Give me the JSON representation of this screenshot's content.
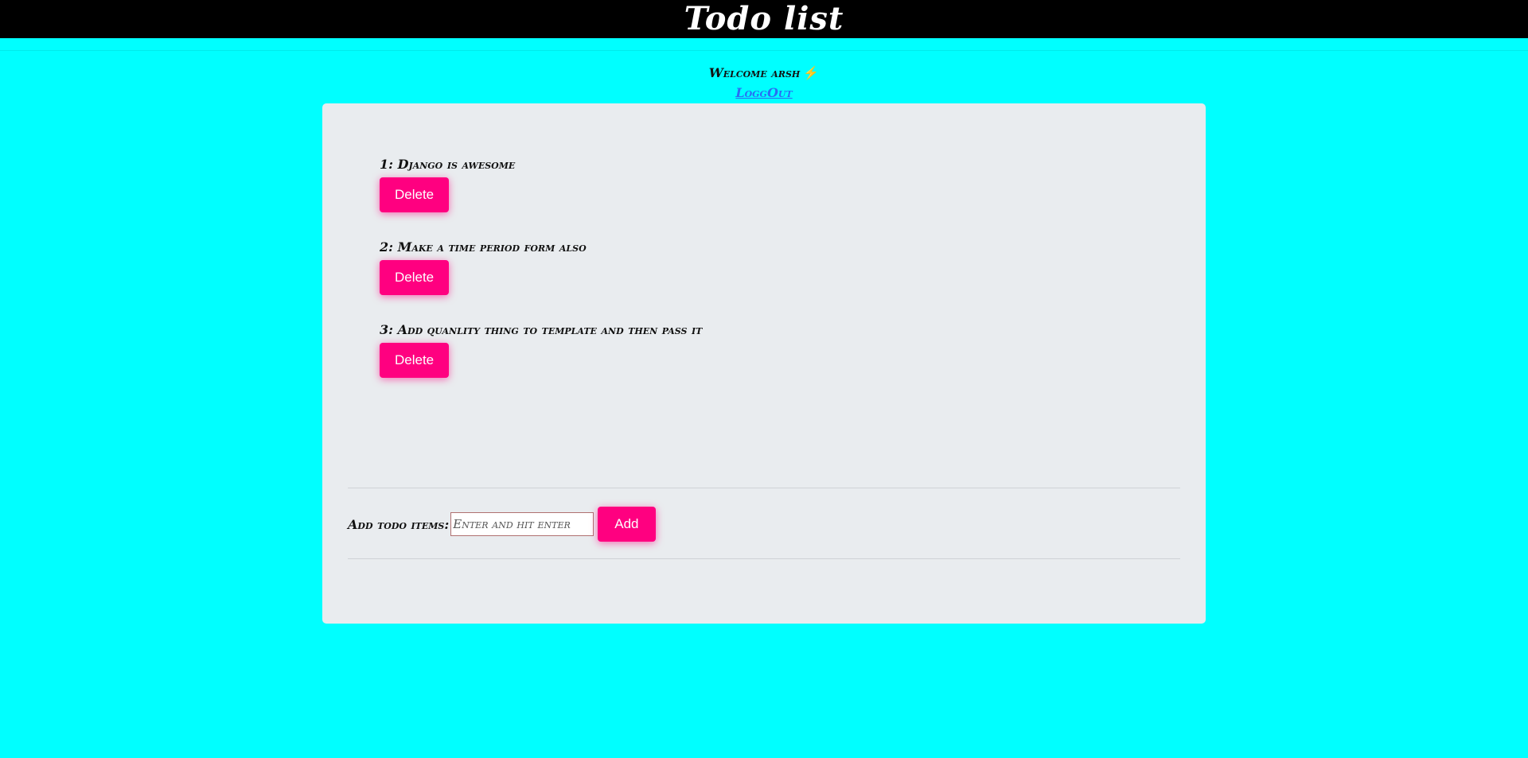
{
  "header": {
    "title": "Todo list"
  },
  "user": {
    "welcome": "Welcome arsh",
    "bolt_icon": "lightning-bolt-icon",
    "logout_label": "LoggOut"
  },
  "todos": [
    {
      "text": "1: Django is awesome",
      "delete_label": "Delete"
    },
    {
      "text": "2: Make a time period form also",
      "delete_label": "Delete"
    },
    {
      "text": "3: Add quanlity thing to template and then pass it",
      "delete_label": "Delete"
    }
  ],
  "add_form": {
    "label": "Add todo items:",
    "placeholder": "Enter and hit enter",
    "button_label": "Add"
  },
  "colors": {
    "page_background": "#00ffff",
    "header_background": "#000000",
    "card_background": "#e9ecef",
    "button": "#ff0080",
    "link": "#2a6df4"
  }
}
